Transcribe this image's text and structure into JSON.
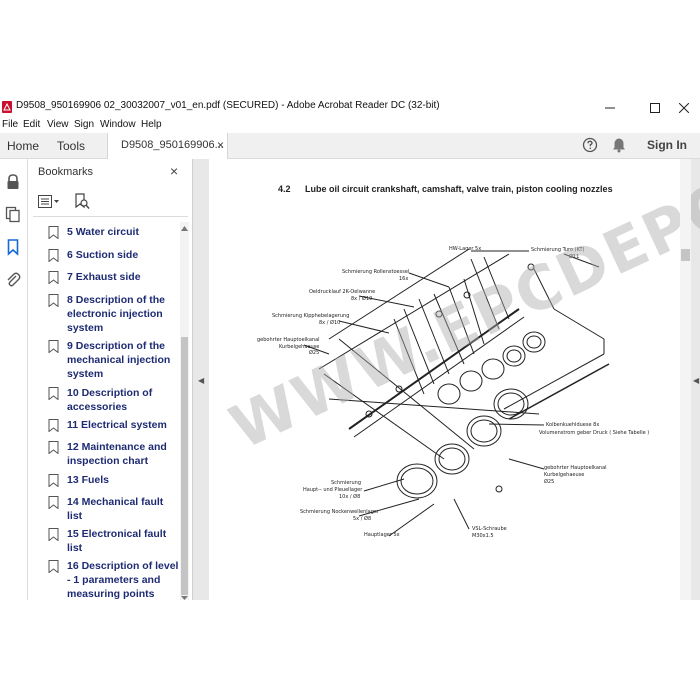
{
  "window": {
    "title": "D9508_950169906 02_30032007_v01_en.pdf (SECURED) - Adobe Acrobat Reader DC (32-bit)",
    "minimize_glyph": "—",
    "maximize_glyph": "☐",
    "close_glyph": "✕"
  },
  "menu": {
    "items": [
      {
        "label": "File"
      },
      {
        "label": "Edit"
      },
      {
        "label": "View"
      },
      {
        "label": "Sign"
      },
      {
        "label": "Window"
      },
      {
        "label": "Help"
      }
    ]
  },
  "tabs": {
    "home": "Home",
    "tools": "Tools",
    "document": "D9508_950169906...",
    "document_close": "×",
    "sign_in": "Sign In"
  },
  "bookmarks": {
    "header": "Bookmarks",
    "close": "×",
    "items": [
      {
        "label": "5 Water circuit"
      },
      {
        "label": "6 Suction side"
      },
      {
        "label": "7 Exhaust side"
      },
      {
        "label": "8 Description of the electronic injection system"
      },
      {
        "label": "9 Description of the mechanical injection system"
      },
      {
        "label": "10 Description of accessories"
      },
      {
        "label": "11 Electrical system"
      },
      {
        "label": "12 Maintenance and inspection chart"
      },
      {
        "label": "13 Fuels"
      },
      {
        "label": "14 Mechanical fault list"
      },
      {
        "label": "15 Electronical fault list"
      },
      {
        "label": "16 Description of level - 1 parameters and measuring points"
      }
    ]
  },
  "document": {
    "section_number": "4.2",
    "section_title": "Lube oil circuit crankshaft, camshaft, valve train, piston cooling nozzles",
    "watermark": "WWW.EPCDEPO.COM",
    "diagram_labels": {
      "l1": "HW-Lager 5x",
      "l2": "Schmierung Turo (KT)",
      "l3": "Ø11",
      "l4": "Schmierung Rollenstoessel",
      "l5": "16x",
      "l6": "Oeldrucklauf 2K-Oelwanne",
      "l7": "8x / Ø10",
      "l8": "Schmierung Kipphebelagerung",
      "l9": "8x / Ø10",
      "l10": "gebohrter Hauptoelkanal",
      "l11": "Kurbelgehaeuse",
      "l12": "Ø25",
      "l13": "Kolbenkuehlduese 8x",
      "l14": "Volumenstrom geber Druck ( Siehe Tabelle )",
      "l15": "gebohrter Hauptoelkanal",
      "l16": "Kurbelgehaeuse",
      "l17": "Ø25",
      "l18": "Schmierung",
      "l19": "Haupt-- und Pleuellager",
      "l20": "10x / Ø8",
      "l21": "Schmierung Nockenwellenlager",
      "l22": "5x / Ø8",
      "l23": "Hauptlager 5x",
      "l24": "VSL-Schraube",
      "l25": "M30x1.5"
    }
  },
  "colors": {
    "bookmark_text": "#1e2b73",
    "tab_bar": "#f0f0f0",
    "doc_background": "#e8e8e8"
  }
}
